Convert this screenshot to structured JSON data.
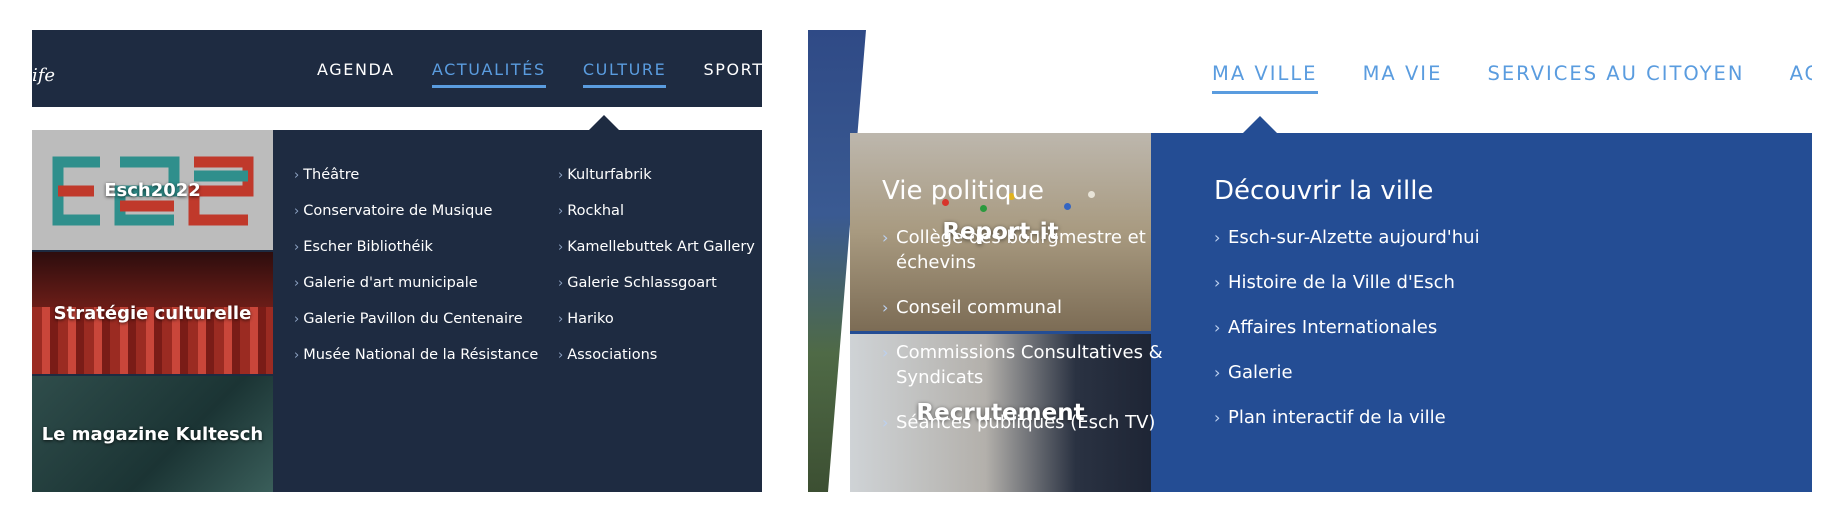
{
  "left": {
    "logo_text": "ife",
    "nav": [
      "AGENDA",
      "ACTUALITÉS",
      "CULTURE",
      "SPORT & L"
    ],
    "tiles": [
      "Esch2022",
      "Stratégie culturelle",
      "Le magazine Kultesch"
    ],
    "links_col1": [
      "Théâtre",
      "Conservatoire de Musique",
      "Escher Bibliothéik",
      "Galerie d'art municipale",
      "Galerie Pavillon du Centenaire",
      "Musée National de la Résistance"
    ],
    "links_col2": [
      "Kulturfabrik",
      "Rockhal",
      "Kamellebuttek Art Gallery",
      "Galerie Schlassgoart",
      "Hariko",
      "Associations"
    ]
  },
  "right": {
    "nav": [
      "MA VILLE",
      "MA VIE",
      "SERVICES AU CITOYEN",
      "ACT"
    ],
    "tiles": [
      "Report-it",
      "Recrutement"
    ],
    "vie_politique": {
      "title": "Vie politique",
      "links": [
        "Collège des bourgmestre et échevins",
        "Conseil communal",
        "Commissions Consultatives & Syndicats",
        "Séances publiques (Esch TV)"
      ]
    },
    "decouvrir": {
      "title": "Découvrir la ville",
      "links": [
        "Esch-sur-Alzette aujourd'hui",
        "Histoire de la Ville d'Esch",
        "Affaires Internationales",
        "Galerie",
        "Plan interactif de la ville"
      ]
    }
  },
  "colors": {
    "navy": "#1e2b41",
    "accent_blue": "#5a9cdf",
    "royal_blue": "#244d94"
  },
  "icons": {
    "link_chevron": "chevron-right-icon"
  }
}
